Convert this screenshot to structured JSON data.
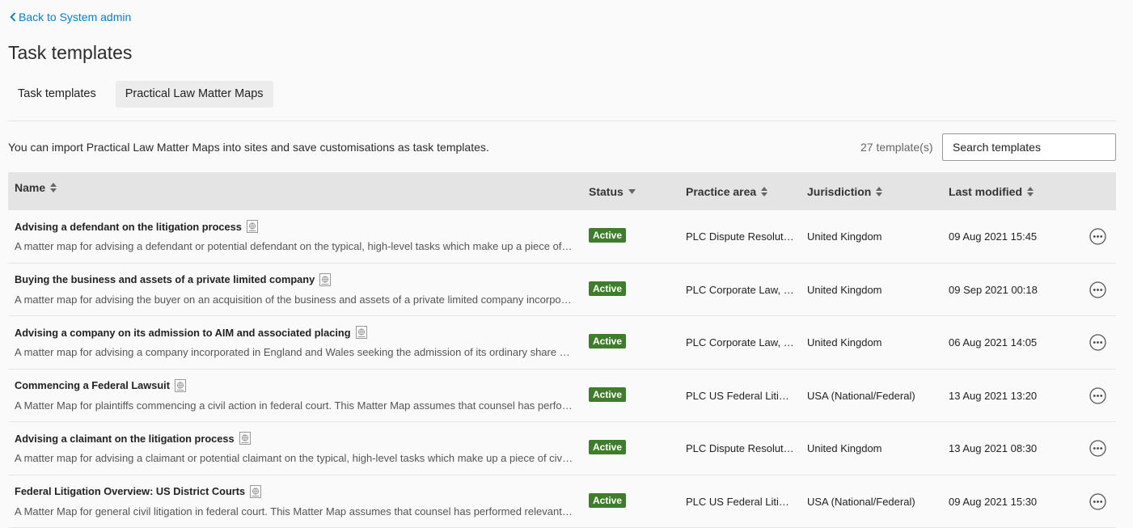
{
  "header": {
    "back_label": "Back to System admin",
    "title": "Task templates"
  },
  "tabs": [
    {
      "label": "Task templates",
      "active": false
    },
    {
      "label": "Practical Law Matter Maps",
      "active": true
    }
  ],
  "toolbar": {
    "intro": "You can import Practical Law Matter Maps into sites and save customisations as task templates.",
    "count": "27 template(s)",
    "search_placeholder": "Search templates"
  },
  "columns": {
    "name": "Name",
    "status": "Status",
    "practice_area": "Practice area",
    "jurisdiction": "Jurisdiction",
    "last_modified": "Last modified"
  },
  "rows": [
    {
      "title": "Advising a defendant on the litigation process",
      "description": "A matter map for advising a defendant or potential defendant on the typical, high-level tasks which make up a piece of litigation",
      "status": "Active",
      "practice_area": "PLC Dispute Resolution",
      "jurisdiction": "United Kingdom",
      "last_modified": "09 Aug 2021 15:45"
    },
    {
      "title": "Buying the business and assets of a private limited company",
      "description": "A matter map for advising the buyer on an acquisition of the business and assets of a private limited company incorporated in England and Wales",
      "status": "Active",
      "practice_area": "PLC Corporate Law, PLC Commercial",
      "jurisdiction": "United Kingdom",
      "last_modified": "09 Sep 2021 00:18"
    },
    {
      "title": "Advising a company on its admission to AIM and associated placing",
      "description": "A matter map for advising a company incorporated in England and Wales seeking the admission of its ordinary share capital to AIM",
      "status": "Active",
      "practice_area": "PLC Corporate Law, PLC Finance",
      "jurisdiction": "United Kingdom",
      "last_modified": "06 Aug 2021 14:05"
    },
    {
      "title": "Commencing a Federal Lawsuit",
      "description": "A Matter Map for plaintiffs commencing a civil action in federal court. This Matter Map assumes that counsel has performed relevant pre-suit tasks",
      "status": "Active",
      "practice_area": "PLC US Federal Litigation",
      "jurisdiction": "USA (National/Federal)",
      "last_modified": "13 Aug 2021 13:20"
    },
    {
      "title": "Advising a claimant on the litigation process",
      "description": "A matter map for advising a claimant or potential claimant on the typical, high-level tasks which make up a piece of civil litigation",
      "status": "Active",
      "practice_area": "PLC Dispute Resolution",
      "jurisdiction": "United Kingdom",
      "last_modified": "13 Aug 2021 08:30"
    },
    {
      "title": "Federal Litigation Overview: US District Courts",
      "description": "A Matter Map for general civil litigation in federal court. This Matter Map assumes that counsel has performed relevant pre-suit tasks",
      "status": "Active",
      "practice_area": "PLC US Federal Litigation",
      "jurisdiction": "USA (National/Federal)",
      "last_modified": "09 Aug 2021 15:30"
    }
  ]
}
